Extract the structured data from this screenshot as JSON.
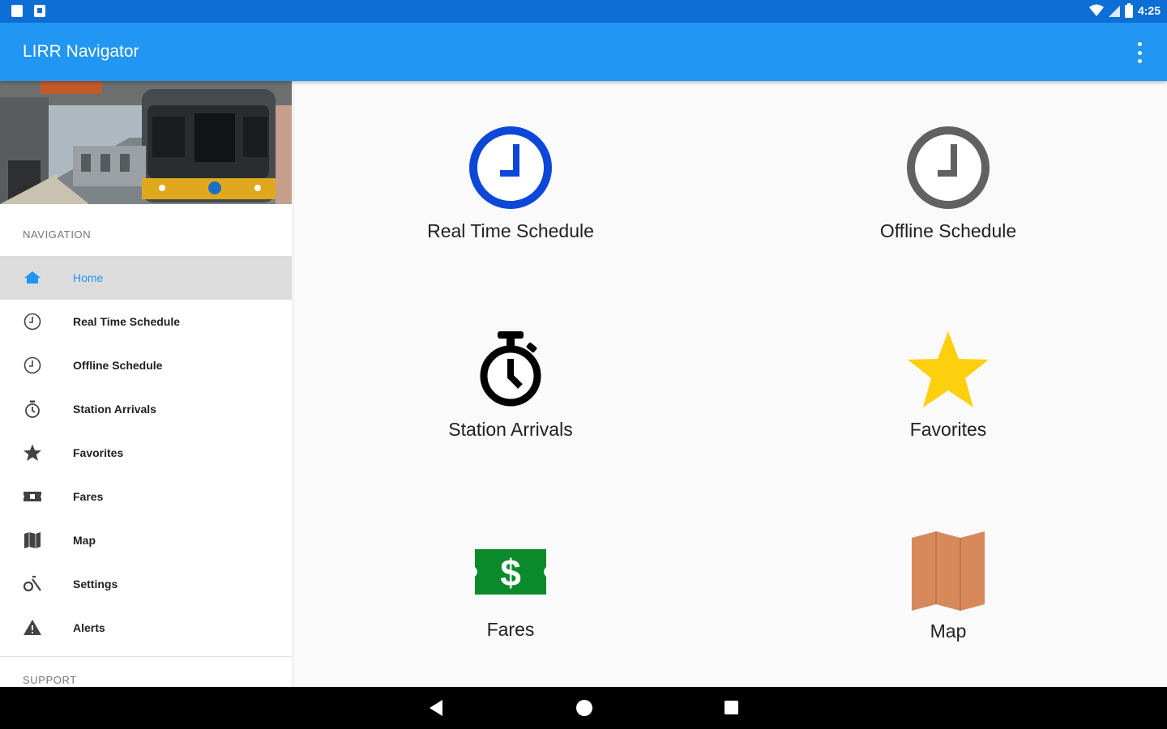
{
  "status_bar": {
    "time": "4:25"
  },
  "app": {
    "title": "LIRR Navigator"
  },
  "drawer": {
    "section_navigation": "NAVIGATION",
    "section_support": "SUPPORT",
    "items": [
      {
        "label": "Home",
        "icon": "home-icon"
      },
      {
        "label": "Real Time Schedule",
        "icon": "clock-icon"
      },
      {
        "label": "Offline Schedule",
        "icon": "clock-icon"
      },
      {
        "label": "Station Arrivals",
        "icon": "stopwatch-icon"
      },
      {
        "label": "Favorites",
        "icon": "star-icon"
      },
      {
        "label": "Fares",
        "icon": "ticket-icon"
      },
      {
        "label": "Map",
        "icon": "map-icon"
      },
      {
        "label": "Settings",
        "icon": "settings-icon"
      },
      {
        "label": "Alerts",
        "icon": "warning-icon"
      }
    ]
  },
  "tiles": [
    {
      "label": "Real Time Schedule",
      "icon": "clock-icon",
      "color": "#0d47d9"
    },
    {
      "label": "Offline Schedule",
      "icon": "clock-icon",
      "color": "#616161"
    },
    {
      "label": "Station Arrivals",
      "icon": "stopwatch-icon",
      "color": "#000000"
    },
    {
      "label": "Favorites",
      "icon": "star-icon",
      "color": "#fdd00f"
    },
    {
      "label": "Fares",
      "icon": "ticket-dollar-icon",
      "color": "#0a8a2a"
    },
    {
      "label": "Map",
      "icon": "map-icon",
      "color": "#d8895c"
    }
  ],
  "colors": {
    "status_bar": "#0d6fd6",
    "app_bar": "#2196f3",
    "accent": "#2196f3"
  }
}
